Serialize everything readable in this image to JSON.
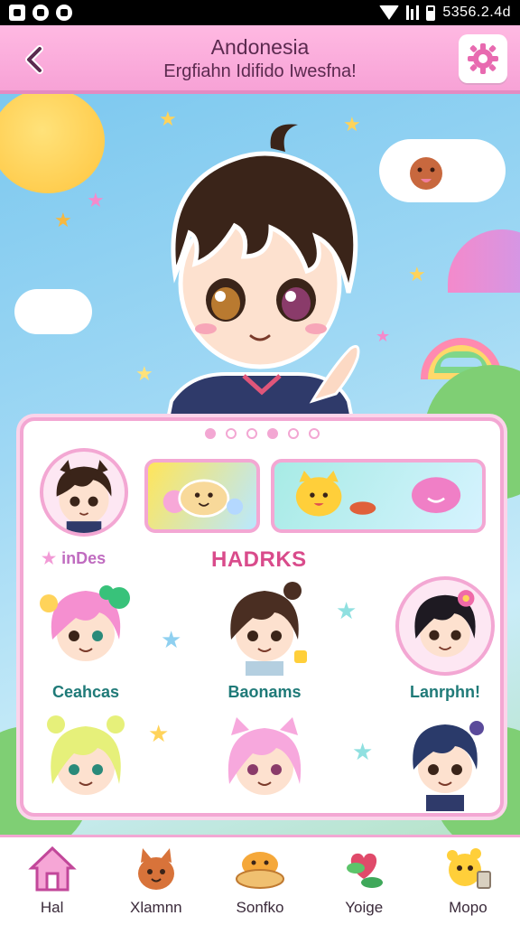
{
  "status_bar": {
    "time": "5356.2.4d"
  },
  "header": {
    "title": "Andonesia",
    "subtitle": "Ergfiahn Idifido Iwesfna!"
  },
  "panel": {
    "section_label": "inDes",
    "section_title": "HADRKS",
    "characters": [
      {
        "name": "Ceahcas",
        "icon": "pink-hair-girl-avatar"
      },
      {
        "name": "Baonams",
        "icon": "brown-hair-girl-avatar"
      },
      {
        "name": "Lanrphn!",
        "icon": "black-hair-girl-avatar"
      },
      {
        "name": "",
        "icon": "blonde-hair-girl-avatar"
      },
      {
        "name": "",
        "icon": "pink-cat-ear-girl-avatar"
      },
      {
        "name": "",
        "icon": "navy-hair-boy-avatar"
      }
    ]
  },
  "nav": {
    "items": [
      {
        "label": "Hal",
        "icon": "house-icon"
      },
      {
        "label": "Xlamnn",
        "icon": "fox-pet-icon"
      },
      {
        "label": "Sonfko",
        "icon": "burger-bowl-icon"
      },
      {
        "label": "Yoige",
        "icon": "heart-plant-icon"
      },
      {
        "label": "Mopo",
        "icon": "yellow-pet-icon"
      }
    ]
  },
  "colors": {
    "accent": "#f3a7d3",
    "header": "#f7a2d6",
    "title": "#d94b8b",
    "name_text": "#1f7a78"
  }
}
